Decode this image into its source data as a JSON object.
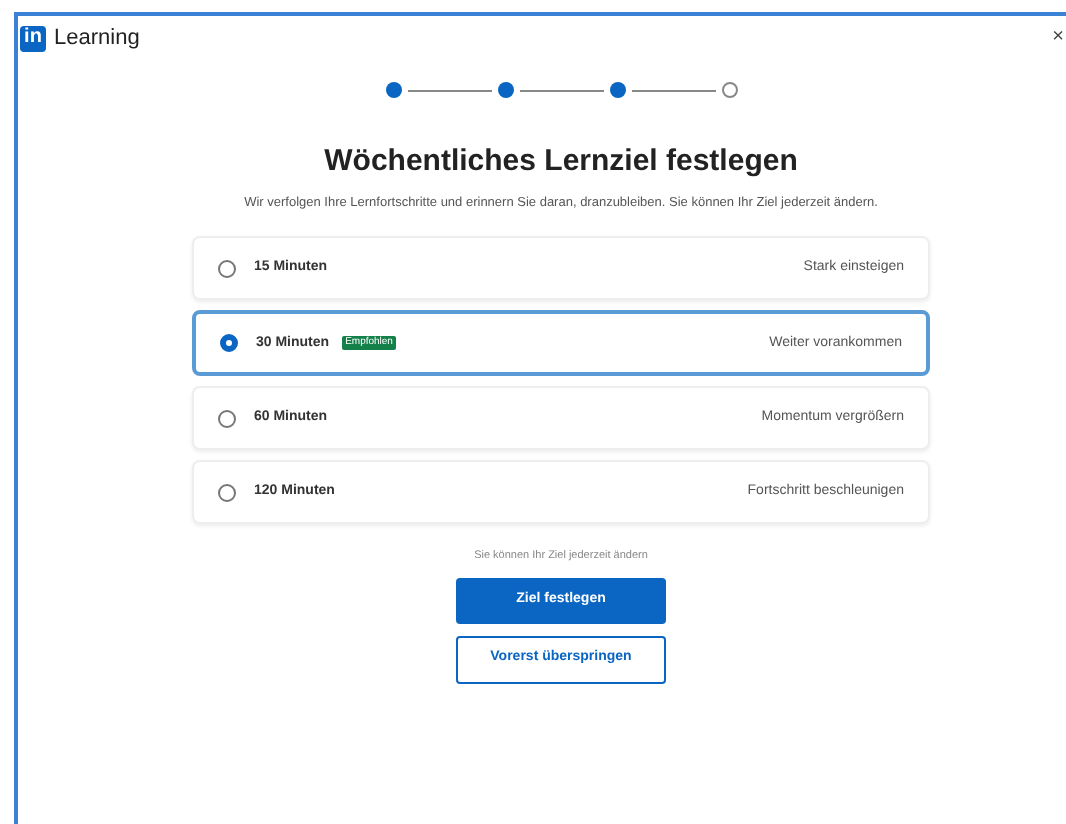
{
  "header": {
    "logo": "in",
    "title": "Learning",
    "close": "×"
  },
  "steps": [
    {
      "done": true
    },
    {
      "done": true
    },
    {
      "done": true
    },
    {
      "done": false
    }
  ],
  "title": "Wöchentliches Lernziel festlegen",
  "subtitle": "Wir verfolgen Ihre Lernfortschritte und erinnern Sie daran, dranzubleiben. Sie können Ihr Ziel jederzeit ändern.",
  "options": [
    {
      "label": "15 Minuten",
      "description": "Stark einsteigen",
      "selected": false
    },
    {
      "label": "30 Minuten",
      "badge": "Empfohlen",
      "description": "Weiter vorankommen",
      "selected": true
    },
    {
      "label": "60 Minuten",
      "description": "Momentum vergrößern",
      "selected": false
    },
    {
      "label": "120 Minuten",
      "description": "Fortschritt beschleunigen",
      "selected": false
    }
  ],
  "note": "Sie können Ihr Ziel jederzeit ändern",
  "primary_button": "Ziel festlegen",
  "secondary_button": "Vorerst überspringen"
}
